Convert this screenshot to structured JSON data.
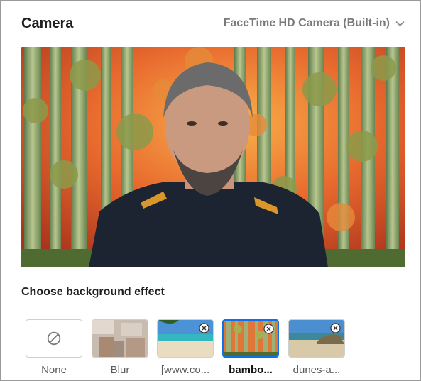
{
  "header": {
    "title": "Camera",
    "camera_name": "FaceTime HD Camera (Built-in)"
  },
  "preview": {
    "image": "person with bamboo and autumn leaves virtual background"
  },
  "effects_section": {
    "label": "Choose background effect",
    "items": [
      {
        "label": "None",
        "icon": "no-effect-icon",
        "removable": false,
        "selected": false
      },
      {
        "label": "Blur",
        "removable": false,
        "selected": false
      },
      {
        "label": "[www.co...",
        "removable": true,
        "selected": false
      },
      {
        "label": "bambo...",
        "removable": true,
        "selected": true
      },
      {
        "label": "dunes-a...",
        "removable": true,
        "selected": false
      }
    ]
  },
  "colors": {
    "selected_border": "#0e71eb",
    "muted_text": "#7a7a7a"
  }
}
